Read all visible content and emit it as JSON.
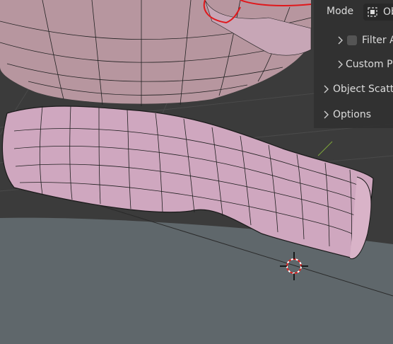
{
  "header": {
    "mode_label": "Mode",
    "mode_value": "Ob"
  },
  "panels": [
    {
      "label": "Filter A",
      "indent": 1,
      "has_checkbox": true
    },
    {
      "label": "Custom Pr",
      "indent": 1,
      "has_checkbox": false
    },
    {
      "label": "Object Scatte",
      "indent": 0,
      "has_checkbox": false
    },
    {
      "label": "Options",
      "indent": 0,
      "has_checkbox": false
    }
  ],
  "viewport": {
    "mesh_color": "#cfa7bf",
    "wire_color": "#1a1a1a",
    "selection_color": "#e0181c",
    "floor_color": "#5e666a",
    "grid_color": "#484848"
  },
  "icons": [
    "object-mode-icon",
    "chevron-right-icon",
    "3d-cursor-icon"
  ]
}
